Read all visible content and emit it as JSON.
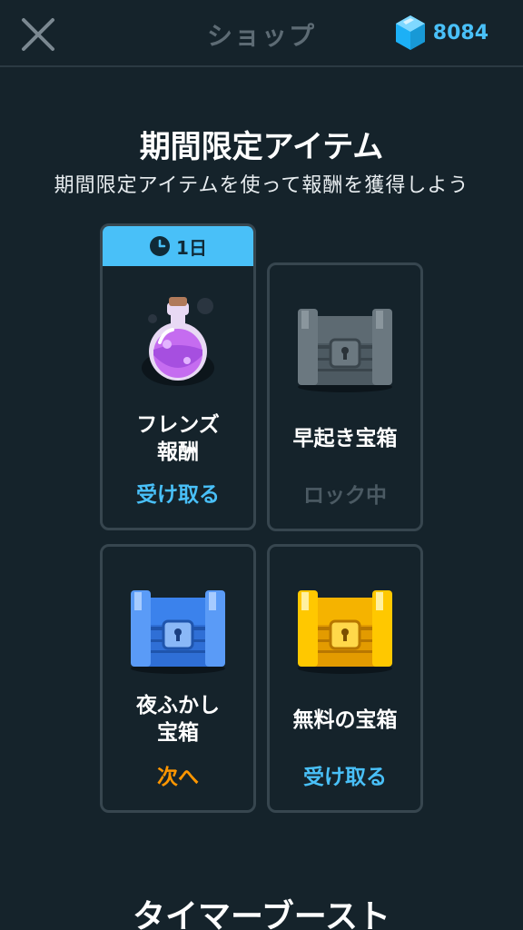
{
  "header": {
    "title": "ショップ",
    "gem_count": "8084",
    "close_icon": "close-icon",
    "gem_icon": "gem-icon"
  },
  "section": {
    "title": "期間限定アイテム",
    "subtitle": "期間限定アイテムを使って報酬を獲得しよう"
  },
  "cards": [
    {
      "badge": "1日",
      "name_line1": "フレンズ",
      "name_line2": "報酬",
      "action": "受け取る",
      "icon": "potion-icon"
    },
    {
      "name_line1": "早起き宝箱",
      "action": "ロック中",
      "icon": "grey-chest-icon"
    },
    {
      "name_line1": "夜ふかし",
      "name_line2": "宝箱",
      "action": "次へ",
      "icon": "blue-chest-icon"
    },
    {
      "name_line1": "無料の宝箱",
      "action": "受け取る",
      "icon": "gold-chest-icon"
    }
  ],
  "section2": {
    "title": "タイマーブースト"
  },
  "colors": {
    "background": "#15232b",
    "accent_blue": "#49c0f8",
    "accent_orange": "#ff9600",
    "muted": "#4b5a63"
  }
}
